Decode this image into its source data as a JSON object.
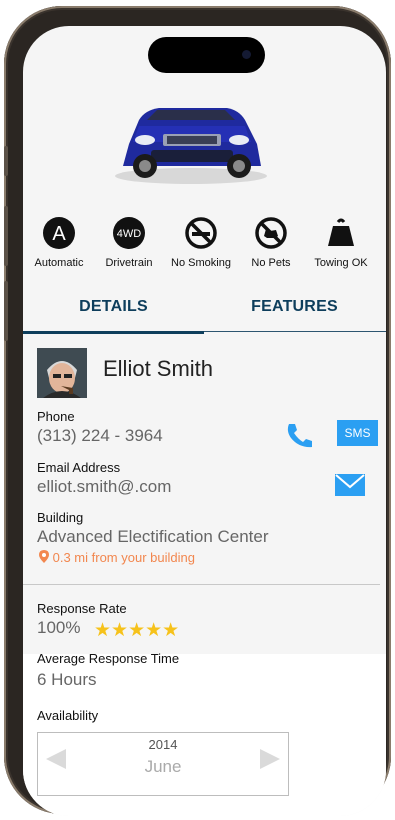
{
  "features": [
    {
      "icon": "automatic-icon",
      "label": "Automatic"
    },
    {
      "icon": "drivetrain-icon",
      "label": "Drivetrain",
      "badge": "4WD"
    },
    {
      "icon": "no-smoking-icon",
      "label": "No Smoking"
    },
    {
      "icon": "no-pets-icon",
      "label": "No Pets"
    },
    {
      "icon": "towing-icon",
      "label": "Towing OK"
    }
  ],
  "automatic_badge": "A",
  "tabs": [
    {
      "label": "DETAILS",
      "active": true
    },
    {
      "label": "FEATURES",
      "active": false
    }
  ],
  "owner": {
    "name": "Elliot Smith",
    "phone_label": "Phone",
    "phone": "(313) 224 - 3964",
    "sms_label": "SMS",
    "email_label": "Email Address",
    "email": "elliot.smith@.com",
    "building_label": "Building",
    "building": "Advanced Electification Center",
    "distance": "0.3 mi from your building",
    "response_rate_label": "Response Rate",
    "response_rate": "100%",
    "rating_stars": 5,
    "stars": "★★★★★",
    "avg_response_label": "Average Response Time",
    "avg_response": "6 Hours",
    "availability_label": "Availability"
  },
  "calendar": {
    "year": "2014",
    "month": "June"
  },
  "colors": {
    "accent": "#0e3e5c",
    "link_blue": "#2b9ff2",
    "star": "#f6c21b",
    "distance": "#f2874f",
    "car": "#1f2a9e"
  }
}
